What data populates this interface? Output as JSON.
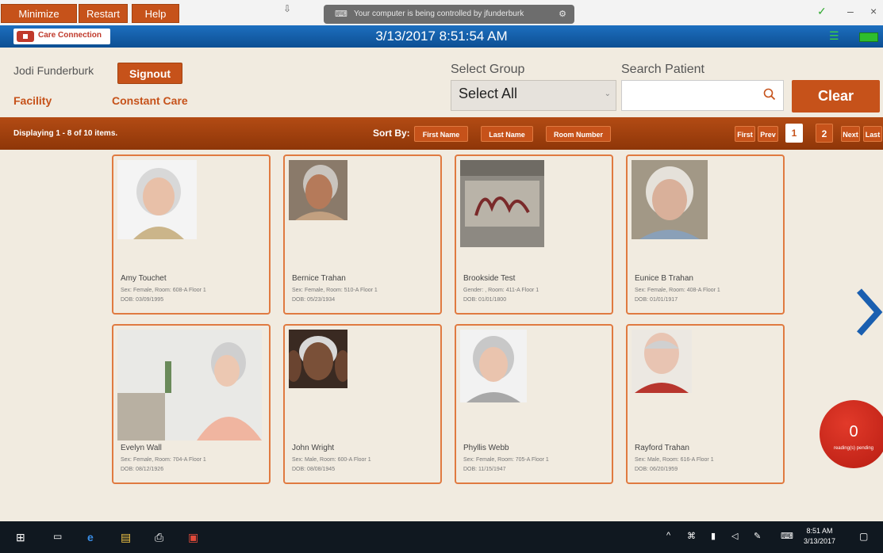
{
  "window": {
    "buttons": {
      "minimize": "Minimize",
      "restart": "Restart",
      "help": "Help"
    },
    "remote_banner": "Your computer is being controlled by jfunderburk"
  },
  "header": {
    "logo_text": "Care Connection",
    "datetime": "3/13/2017 8:51:54 AM"
  },
  "user": {
    "name": "Jodi Funderburk",
    "signout_label": "Signout",
    "facility_label": "Facility",
    "facility_value": "Constant Care"
  },
  "filters": {
    "group_label": "Select Group",
    "group_selected": "Select All",
    "search_label": "Search Patient",
    "search_value": "",
    "clear_label": "Clear"
  },
  "sortbar": {
    "display_text": "Displaying 1 - 8 of 10 items.",
    "sort_label": "Sort By:",
    "sort_buttons": [
      "First Name",
      "Last Name",
      "Room Number"
    ],
    "paging": {
      "first": "First",
      "prev": "Prev",
      "pages": [
        "1",
        "2"
      ],
      "current_page": "1",
      "next": "Next",
      "last": "Last"
    }
  },
  "patients": [
    {
      "name": "Amy Touchet",
      "info": "Sex: Female, Room: 608-A Floor 1",
      "dob": "DOB: 03/09/1995"
    },
    {
      "name": "Bernice Trahan",
      "info": "Sex: Female, Room: 510-A Floor 1",
      "dob": "DOB: 05/23/1934"
    },
    {
      "name": "Brookside Test",
      "info": "Gender: , Room: 411-A Floor 1",
      "dob": "DOB: 01/01/1800"
    },
    {
      "name": "Eunice B Trahan",
      "info": "Sex: Female, Room: 408-A Floor 1",
      "dob": "DOB: 01/01/1917"
    },
    {
      "name": "Evelyn Wall",
      "info": "Sex: Female, Room: 704-A Floor 1",
      "dob": "DOB: 08/12/1926"
    },
    {
      "name": "John Wright",
      "info": "Sex: Male, Room: 600-A Floor 1",
      "dob": "DOB: 08/08/1945"
    },
    {
      "name": "Phyllis Webb",
      "info": "Sex: Female, Room: 705-A Floor 1",
      "dob": "DOB: 11/15/1947"
    },
    {
      "name": "Rayford Trahan",
      "info": "Sex: Male, Room: 616-A Floor 1",
      "dob": "DOB: 06/20/1959"
    }
  ],
  "pending": {
    "count": "0",
    "label": "reading(s) pending"
  },
  "taskbar": {
    "time": "8:51 AM",
    "date": "3/13/2017"
  },
  "colors": {
    "accent": "#c6521a",
    "header_blue": "#0d4f93",
    "background": "#f1ebe0",
    "next_arrow": "#1a5fb0",
    "pending_red": "#c62218"
  },
  "icons": [
    "search-icon",
    "chevron-right-icon",
    "wifi-icon",
    "battery-icon",
    "windows-start-icon"
  ]
}
